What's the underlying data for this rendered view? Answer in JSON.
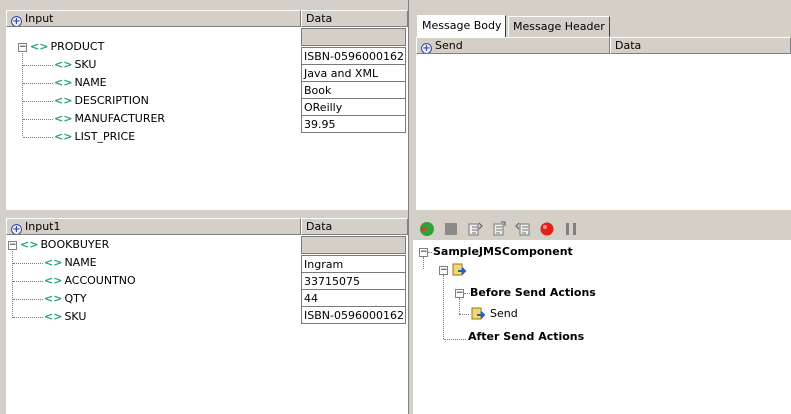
{
  "input_panel": {
    "header_col1": "Input",
    "header_col2": "Data",
    "root": "PRODUCT",
    "fields": [
      "SKU",
      "NAME",
      "DESCRIPTION",
      "MANUFACTURER",
      "LIST_PRICE"
    ],
    "values": [
      "ISBN-0596000162",
      "Java and XML",
      "Book",
      "OReilly",
      "39.95"
    ]
  },
  "input1_panel": {
    "header_col1": "Input1",
    "header_col2": "Data",
    "root": "BOOKBUYER",
    "fields": [
      "NAME",
      "ACCOUNTNO",
      "QTY",
      "SKU"
    ],
    "values": [
      "Ingram",
      "33715075",
      "44",
      "ISBN-0596000162"
    ]
  },
  "message_panel": {
    "tabs": [
      "Message Body",
      "Message Header"
    ],
    "header_col1": "Send",
    "header_col2": "Data"
  },
  "component_tree": {
    "root": "SampleJMSComponent",
    "before": "Before Send Actions",
    "send": "Send",
    "after": "After Send Actions"
  },
  "toolbar": {
    "icons": [
      "run-icon",
      "stop-icon",
      "step-icon",
      "step-over-icon",
      "step-back-icon",
      "breakpoint-icon",
      "pause-icon"
    ]
  },
  "tag_glyph": "<>"
}
